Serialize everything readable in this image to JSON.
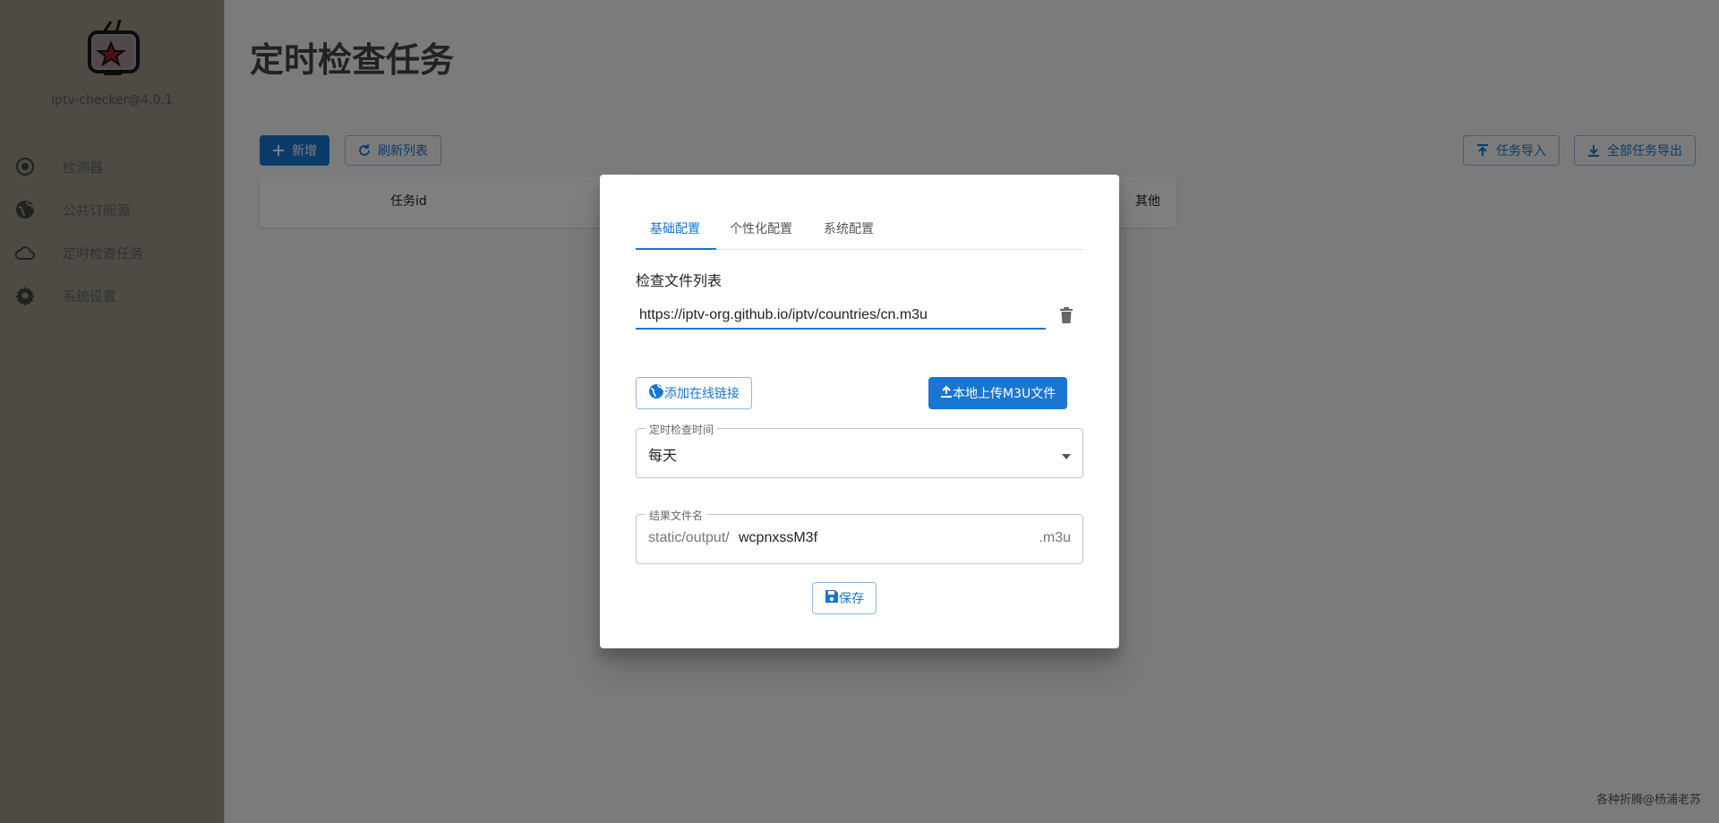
{
  "app": {
    "version": "iptv-checker@4.0.1",
    "footer": "各种折腾@杨浦老苏"
  },
  "sidebar": {
    "items": [
      {
        "label": "检测器",
        "icon": "radio-button-icon"
      },
      {
        "label": "公共订阅源",
        "icon": "globe-icon"
      },
      {
        "label": "定时检查任务",
        "icon": "cloud-icon"
      },
      {
        "label": "系统设置",
        "icon": "gear-icon"
      }
    ]
  },
  "page": {
    "title": "定时检查任务",
    "toolbar": {
      "add_label": "新增",
      "refresh_label": "刷新列表",
      "import_label": "任务导入",
      "export_label": "全部任务导出"
    },
    "table": {
      "columns": [
        "任务id",
        "其他"
      ]
    }
  },
  "dialog": {
    "tabs": [
      {
        "label": "基础配置",
        "active": true
      },
      {
        "label": "个性化配置",
        "active": false
      },
      {
        "label": "系统配置",
        "active": false
      }
    ],
    "file_list_label": "检查文件列表",
    "urls": [
      "https://iptv-org.github.io/iptv/countries/cn.m3u"
    ],
    "add_link_label": "添加在线链接",
    "upload_label": "本地上传M3U文件",
    "schedule": {
      "label": "定时检查时间",
      "value": "每天"
    },
    "result_file": {
      "label": "结果文件名",
      "prefix": "static/output/",
      "value": "wcpnxssM3f",
      "suffix": ".m3u"
    },
    "save_label": "保存"
  },
  "colors": {
    "primary": "#1976d2",
    "sidebar_bg": "#f0e6d7",
    "overlay": "rgba(0,0,0,0.5)"
  }
}
